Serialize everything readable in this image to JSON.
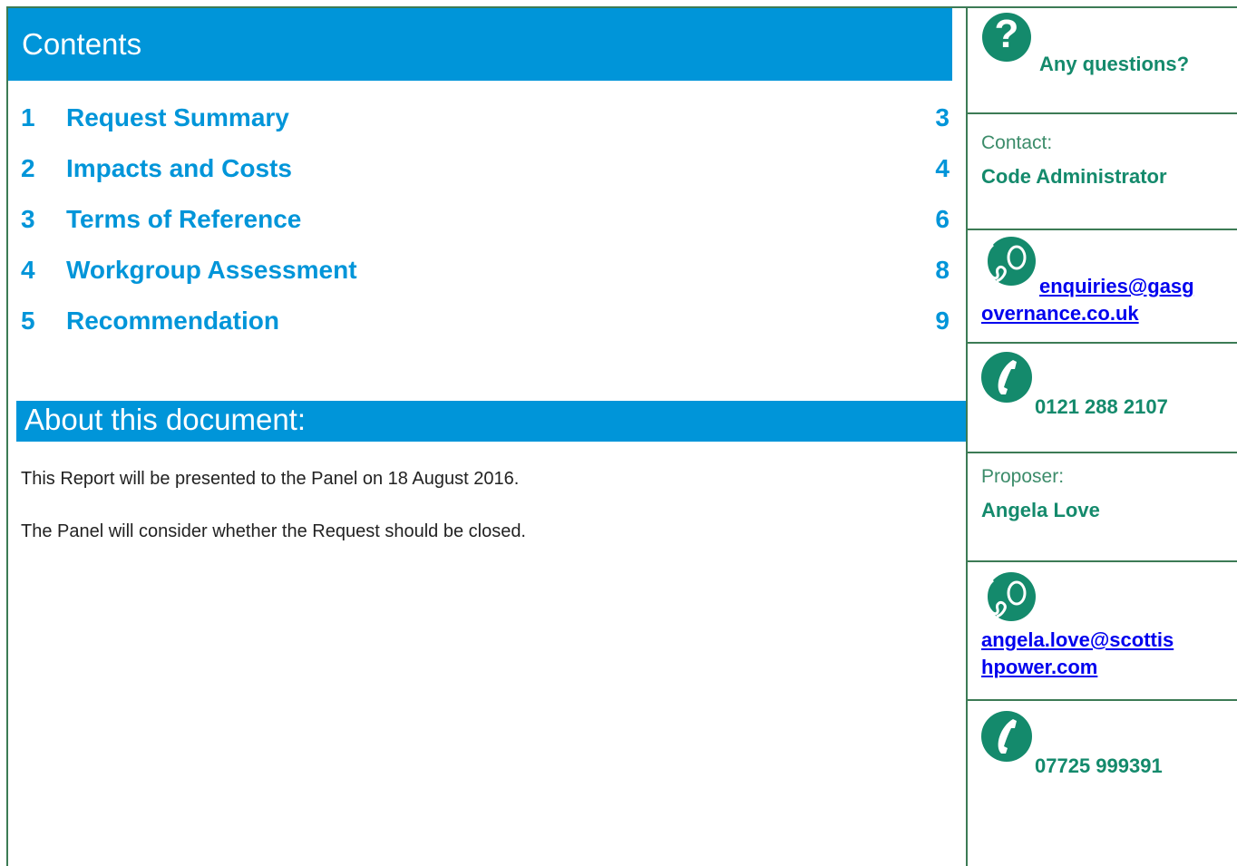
{
  "contents": {
    "heading": "Contents",
    "items": [
      {
        "num": "1",
        "title": "Request Summary",
        "page": "3"
      },
      {
        "num": "2",
        "title": "Impacts and Costs",
        "page": "4"
      },
      {
        "num": "3",
        "title": "Terms of Reference",
        "page": "6"
      },
      {
        "num": "4",
        "title": "Workgroup Assessment",
        "page": "8"
      },
      {
        "num": "5",
        "title": "Recommendation",
        "page": "9"
      }
    ]
  },
  "about": {
    "heading": "About this document:",
    "paragraphs": [
      "This Report will be presented to the Panel on 18 August 2016.",
      "The Panel will consider whether the Request should be closed."
    ]
  },
  "sidebar": {
    "questions": "Any questions?",
    "contact_label": "Contact:",
    "contact_name": "Code Administrator",
    "contact_email_1": "enquiries@gasg",
    "contact_email_2": "overnance.co.uk",
    "contact_phone": "0121 288 2107",
    "proposer_label": "Proposer:",
    "proposer_name": "Angela Love",
    "proposer_email_1": "angela.love@scottis",
    "proposer_email_2": "hpower.com",
    "proposer_phone": "07725 999391"
  },
  "colors": {
    "accent_blue": "#0095d9",
    "accent_green": "#148a6c",
    "border_green": "#3c7b55"
  }
}
